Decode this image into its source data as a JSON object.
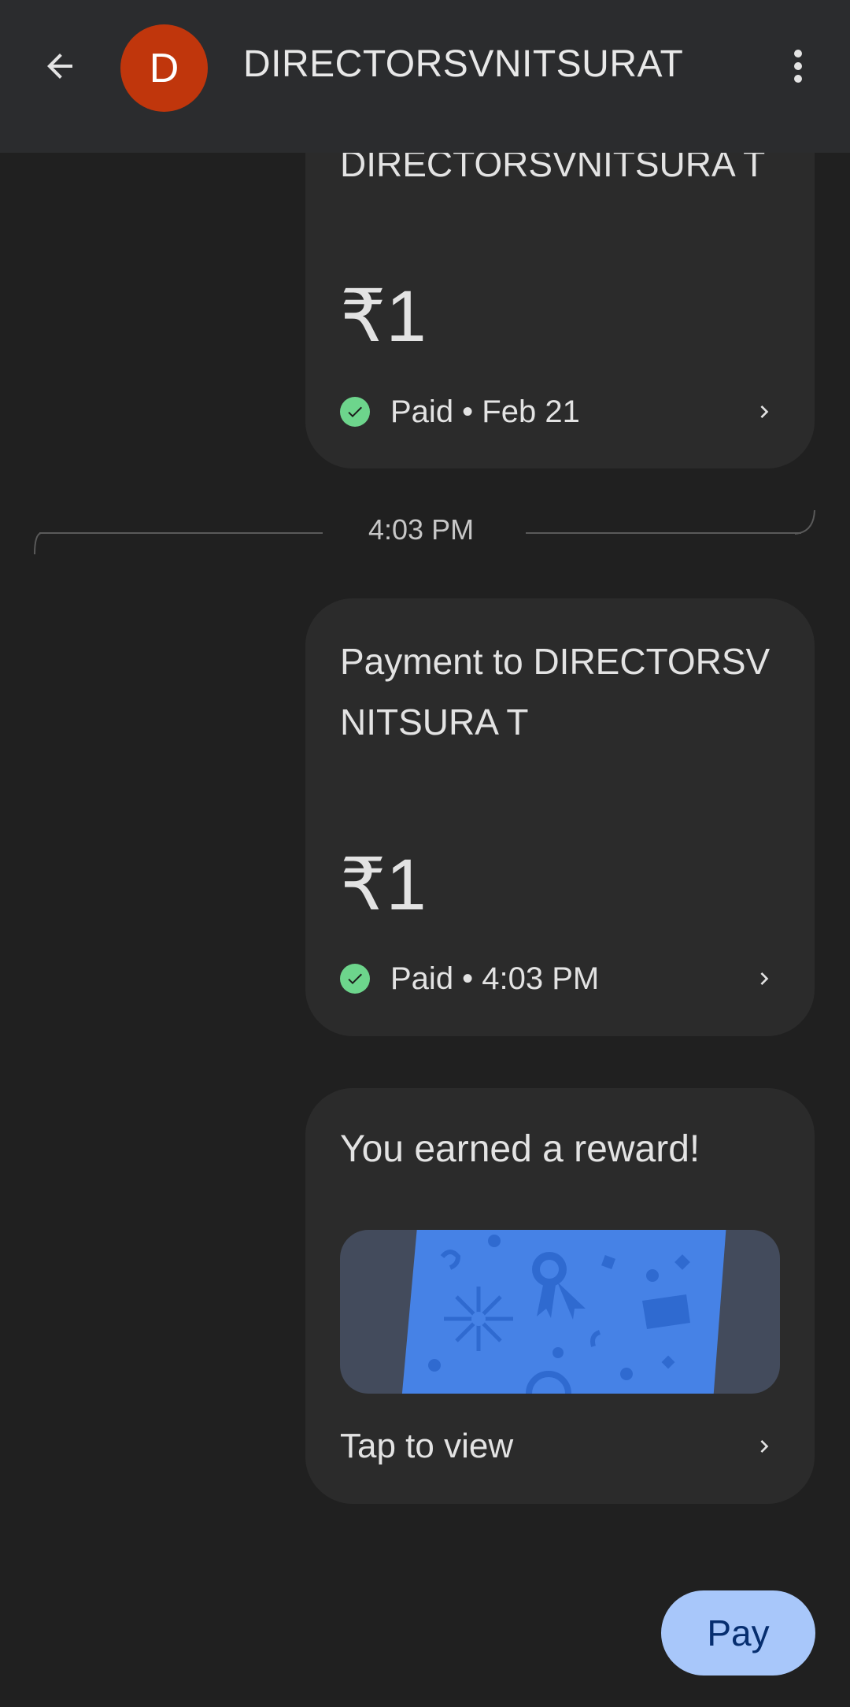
{
  "header": {
    "avatar_letter": "D",
    "title": "DIRECTORSVNITSURAT",
    "back_icon": "arrow-back-icon",
    "more_icon": "more-vert-icon",
    "avatar_color": "#c0360c"
  },
  "messages": [
    {
      "payee_text": "DIRECTORSVNITSURA T",
      "amount": "₹1",
      "status": "Paid • Feb 21"
    },
    {
      "payee_text": "Payment to DIRECTORSVNITSURA T",
      "amount": "₹1",
      "status": "Paid • 4:03 PM"
    }
  ],
  "divider": {
    "time": "4:03 PM"
  },
  "reward": {
    "title": "You earned a reward!",
    "action": "Tap to view"
  },
  "fab": {
    "label": "Pay",
    "color": "#a8c7fa"
  },
  "colors": {
    "success": "#6dd58c",
    "background": "#202020",
    "card": "#2b2b2b"
  }
}
